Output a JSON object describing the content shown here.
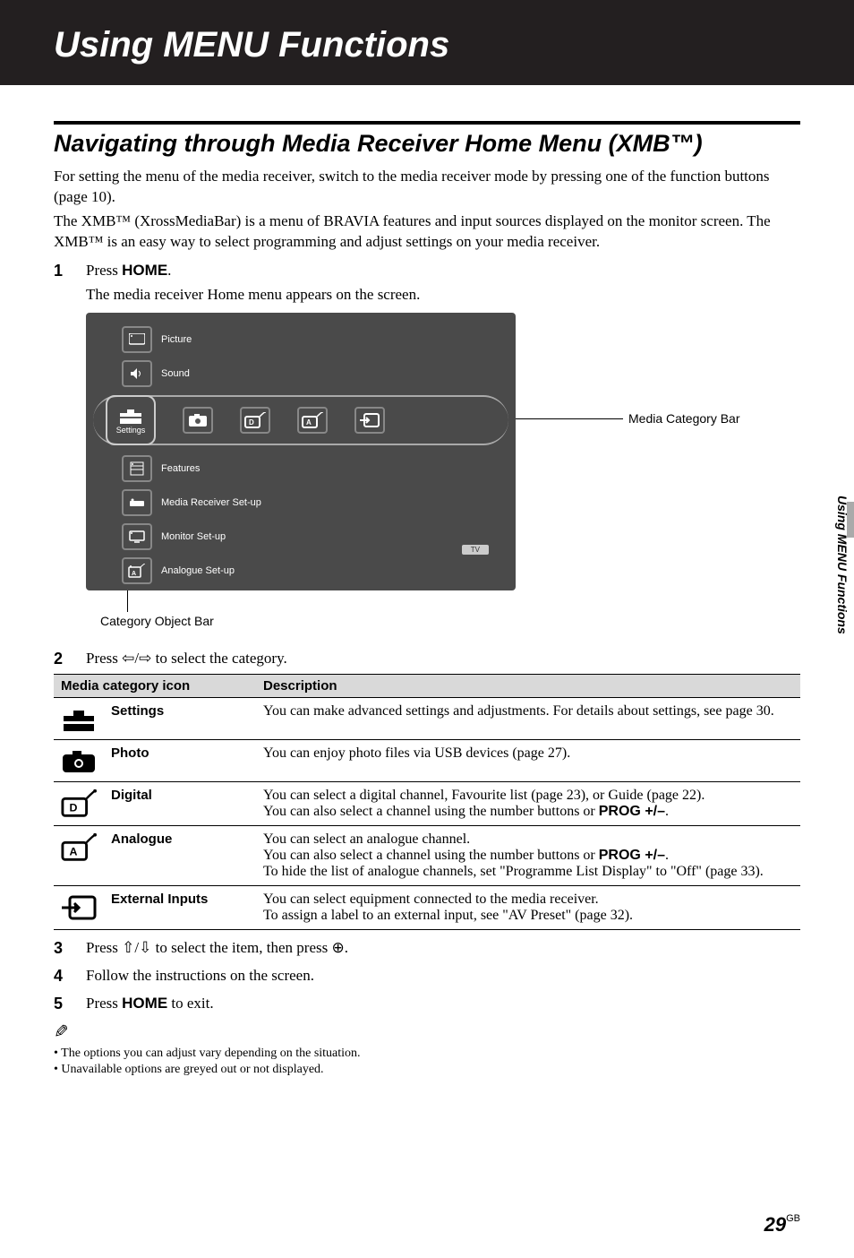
{
  "header": {
    "title": "Using MENU Functions"
  },
  "section": {
    "title": "Navigating through Media Receiver Home Menu (XMB™)",
    "para1": "For setting the menu of the media receiver, switch to the media receiver mode by pressing one of the function buttons (page 10).",
    "para2": "The XMB™ (XrossMediaBar) is a menu of BRAVIA features and input sources displayed on the monitor screen. The XMB™ is an easy way to select programming and adjust settings on your media receiver."
  },
  "steps": {
    "s1_num": "1",
    "s1_pre": "Press ",
    "s1_btn": "HOME",
    "s1_post": ".",
    "s1_sub": "The media receiver Home menu appears on the screen.",
    "s2_num": "2",
    "s2_text": "Press ⇦/⇨ to select the category.",
    "s3_num": "3",
    "s3_text": "Press ⇧/⇩ to select the item, then press ⊕.",
    "s4_num": "4",
    "s4_text": "Follow the instructions on the screen.",
    "s5_num": "5",
    "s5_pre": "Press ",
    "s5_btn": "HOME",
    "s5_post": " to exit."
  },
  "diagram": {
    "media_bar_label": "Media Category Bar",
    "category_bar_label": "Category Object Bar",
    "tv_badge": "TV",
    "vtop": [
      {
        "icon": "🖵",
        "label": "Picture"
      },
      {
        "icon": "🔊",
        "label": "Sound"
      }
    ],
    "selected_label": "Settings",
    "hicons": [
      "📷",
      "D",
      "A",
      "�infini"
    ],
    "vbot": [
      {
        "icon": "▤",
        "label": "Features"
      },
      {
        "icon": "▭",
        "label": "Media Receiver Set-up"
      },
      {
        "icon": "🖵",
        "label": "Monitor Set-up"
      },
      {
        "icon": "A",
        "label": "Analogue Set-up"
      }
    ]
  },
  "table": {
    "head_icon": "Media category icon",
    "head_desc": "Description",
    "rows": [
      {
        "name": "Settings",
        "desc": "You can make advanced settings and adjustments. For details about settings, see page 30."
      },
      {
        "name": "Photo",
        "desc": "You can enjoy photo files via USB devices (page 27)."
      },
      {
        "name": "Digital",
        "desc_pre": "You can select a digital channel, Favourite list (page 23), or Guide (page 22).\nYou can also select a channel using the number buttons or ",
        "desc_bold": "PROG +/–",
        "desc_post": "."
      },
      {
        "name": "Analogue",
        "desc_pre": "You can select an analogue channel.\nYou can also select a channel using the number buttons or ",
        "desc_bold": "PROG +/–",
        "desc_post": ".\nTo hide the list of analogue channels, set \"Programme List Display\" to \"Off\" (page 33)."
      },
      {
        "name": "External Inputs",
        "desc": "You can select equipment connected to the media receiver.\nTo assign a label to an external input, see \"AV Preset\" (page 32)."
      }
    ]
  },
  "notes": {
    "n1": "The options you can adjust vary depending on the situation.",
    "n2": "Unavailable options are greyed out or not displayed."
  },
  "side_tab": "Using MENU Functions",
  "page": {
    "num": "29",
    "gb": "GB"
  }
}
